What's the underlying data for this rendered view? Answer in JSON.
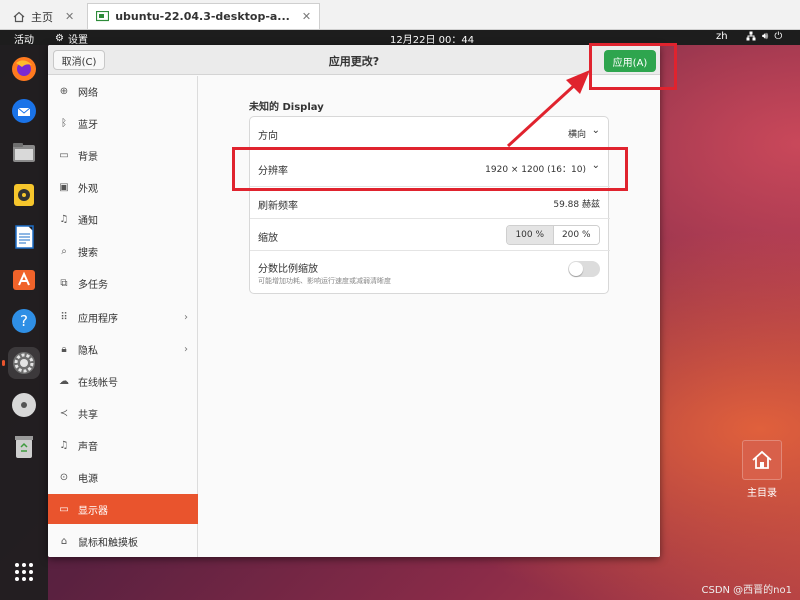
{
  "vm_tabs": [
    {
      "label": "主页",
      "icon": "home-icon"
    },
    {
      "label": "ubuntu-22.04.3-desktop-a...",
      "icon": "vm-icon"
    }
  ],
  "topbar": {
    "activities": "活动",
    "app_name": "设置",
    "clock": "12月22日 00：44",
    "lang": "zh"
  },
  "window": {
    "cancel_label": "取消(C)",
    "title": "应用更改?",
    "apply_label": "应用(A)"
  },
  "sidebar": {
    "items": [
      {
        "label": "网络",
        "icon": "network-icon"
      },
      {
        "label": "蓝牙",
        "icon": "bluetooth-icon"
      },
      {
        "label": "背景",
        "icon": "background-icon"
      },
      {
        "label": "外观",
        "icon": "appearance-icon"
      },
      {
        "label": "通知",
        "icon": "bell-icon"
      },
      {
        "label": "搜索",
        "icon": "search-icon"
      },
      {
        "label": "多任务",
        "icon": "multitask-icon"
      },
      {
        "label": "应用程序",
        "icon": "apps-icon"
      },
      {
        "label": "隐私",
        "icon": "lock-icon"
      },
      {
        "label": "在线帐号",
        "icon": "cloud-icon"
      },
      {
        "label": "共享",
        "icon": "share-icon"
      },
      {
        "label": "声音",
        "icon": "music-icon"
      },
      {
        "label": "电源",
        "icon": "power-icon"
      },
      {
        "label": "显示器",
        "icon": "display-icon"
      },
      {
        "label": "鼠标和触摸板",
        "icon": "mouse-icon"
      }
    ]
  },
  "display": {
    "section_title": "未知的 Display",
    "orientation_label": "方向",
    "orientation_value": "横向",
    "resolution_label": "分辨率",
    "resolution_value": "1920 × 1200 (16：10)",
    "refresh_label": "刷新频率",
    "refresh_value": "59.88 赫兹",
    "scale_label": "缩放",
    "scale_options": [
      "100 %",
      "200 %"
    ],
    "fractional_label": "分数比例缩放",
    "fractional_sub": "可能增加功耗、影响运行速度或减弱清晰度"
  },
  "desktop": {
    "home_label": "主目录",
    "watermark": "CSDN @西晋的no1"
  },
  "colors": {
    "accent": "#e9542d",
    "apply_green": "#2ea54e",
    "annotation_red": "#e0232e"
  }
}
